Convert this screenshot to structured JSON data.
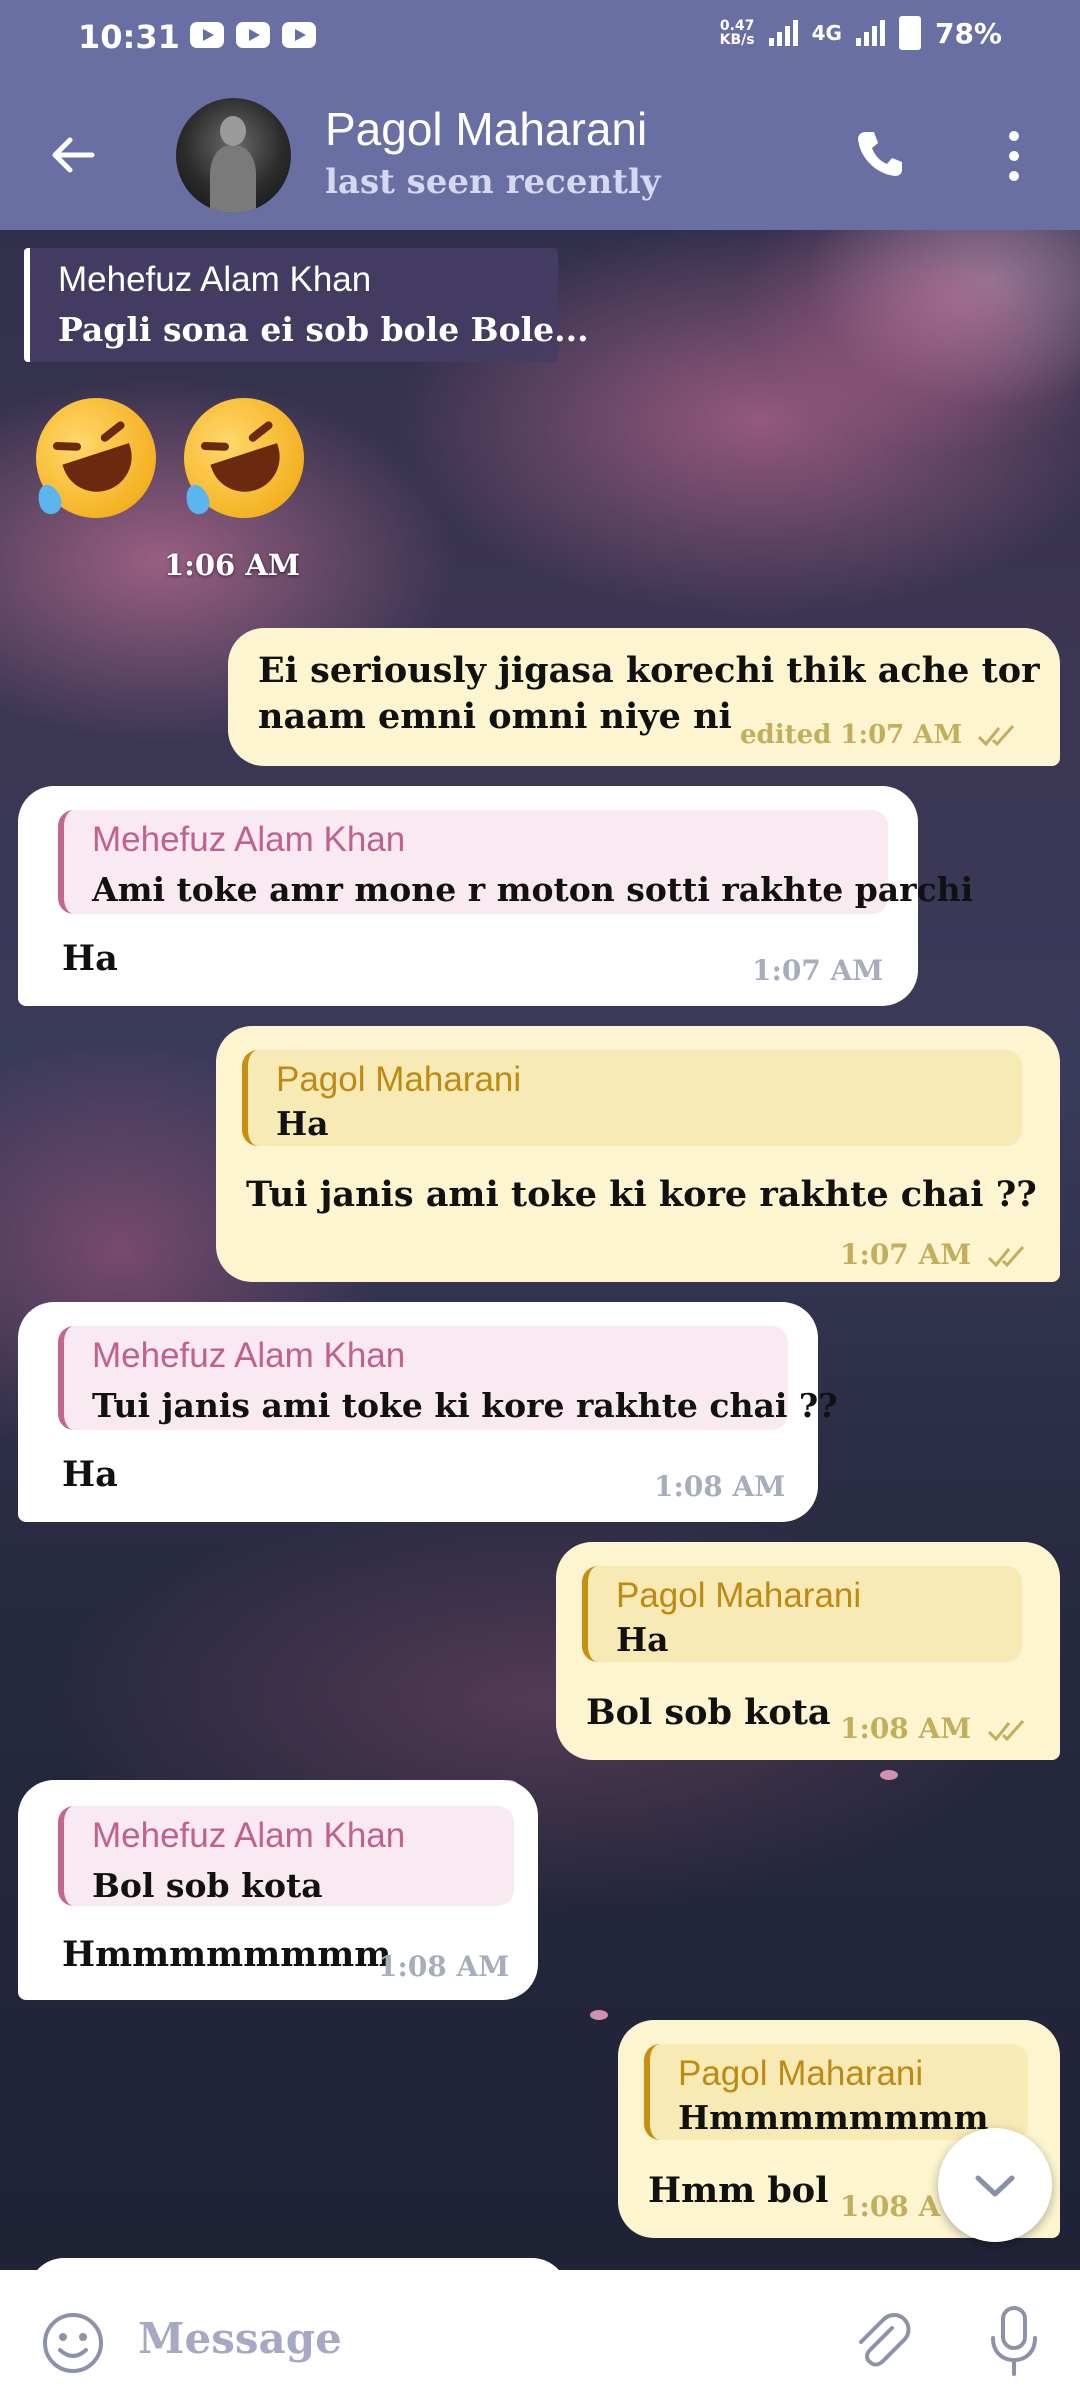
{
  "status_bar": {
    "time": "10:31",
    "net_speed_value": "0.47",
    "net_speed_unit": "KB/s",
    "network": "4G",
    "battery": "78%"
  },
  "header": {
    "contact_name": "Pagol Maharani",
    "status": "last seen recently"
  },
  "messages": {
    "quoted_top": {
      "sender": "Mehefuz Alam Khan",
      "text": "Pagli sona ei sob bole Bole..."
    },
    "emoji_time": "1:06 AM",
    "m1": {
      "text1": "Ei seriously jigasa korechi thik ache tor",
      "text2": "naam emni omni niye ni",
      "meta": "edited 1:07 AM"
    },
    "m2": {
      "reply_name": "Mehefuz Alam Khan",
      "reply_text": "Ami toke amr mone r moton sotti rakhte parchi",
      "text": "Ha",
      "time": "1:07 AM"
    },
    "m3": {
      "reply_name": "Pagol Maharani",
      "reply_text": "Ha",
      "text": "Tui janis ami toke ki kore rakhte chai ??",
      "time": "1:07 AM"
    },
    "m4": {
      "reply_name": "Mehefuz Alam Khan",
      "reply_text": "Tui janis ami toke ki kore rakhte chai ??",
      "text": "Ha",
      "time": "1:08 AM"
    },
    "m5": {
      "reply_name": "Pagol Maharani",
      "reply_text": "Ha",
      "text": "Bol sob kota",
      "time": "1:08 AM"
    },
    "m6": {
      "reply_name": "Mehefuz Alam Khan",
      "reply_text": "Bol sob kota",
      "text": "Hmmmmmmmm",
      "time": "1:08 AM"
    },
    "m7": {
      "reply_name": "Pagol Maharani",
      "reply_text": "Hmmmmmmmm",
      "text": "Hmm bol",
      "time": "1:08 A"
    }
  },
  "composer": {
    "placeholder": "Message"
  },
  "colors": {
    "header": "#6a6fa3",
    "outgoing_bubble": "#fcf5cf",
    "incoming_bubble": "#ffffff",
    "incoming_reply_accent": "#c2688f",
    "outgoing_reply_accent": "#c58f12",
    "tick": "#c3ae5b"
  },
  "icons": [
    "back-arrow-icon",
    "phone-icon",
    "more-vertical-icon",
    "emoji-icon",
    "attach-icon",
    "mic-icon",
    "chevron-down-icon",
    "double-check-icon"
  ]
}
